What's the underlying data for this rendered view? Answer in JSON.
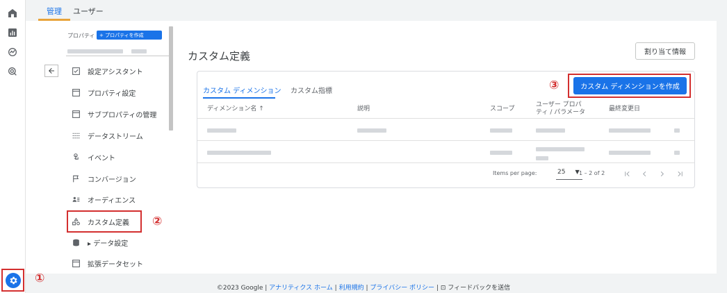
{
  "top_tabs": [
    {
      "label": "管理",
      "active": true
    },
    {
      "label": "ユーザー",
      "active": false
    }
  ],
  "rail": {
    "icons": [
      "home-icon",
      "reports-icon",
      "explore-icon",
      "advertising-icon"
    ],
    "settings_icon": "gear-icon",
    "callout": "①"
  },
  "property": {
    "label": "プロパティ",
    "create_button": "+ プロパティを作成"
  },
  "nav_items": [
    {
      "label": "設定アシスタント",
      "icon": "checklist-icon"
    },
    {
      "label": "プロパティ設定",
      "icon": "box-icon"
    },
    {
      "label": "サブプロパティの管理",
      "icon": "box-icon"
    },
    {
      "label": "データストリーム",
      "icon": "streams-icon"
    },
    {
      "label": "イベント",
      "icon": "touch-icon"
    },
    {
      "label": "コンバージョン",
      "icon": "flag-icon"
    },
    {
      "label": "オーディエンス",
      "icon": "audience-icon"
    },
    {
      "label": "カスタム定義",
      "icon": "shapes-icon"
    },
    {
      "label": "▸ データ設定",
      "icon": "database-icon"
    },
    {
      "label": "拡張データセット",
      "icon": "box-icon"
    }
  ],
  "nav_callout": "②",
  "page": {
    "title": "カスタム定義",
    "assign_button": "割り当て情報"
  },
  "tabs": [
    {
      "label": "カスタム ディメンション",
      "active": true
    },
    {
      "label": "カスタム指標",
      "active": false
    }
  ],
  "create_dimension_button": "カスタム ディメンションを作成",
  "create_callout": "③",
  "table": {
    "headers": {
      "name": "ディメンション名 ↑",
      "description": "説明",
      "scope": "スコープ",
      "user_property": "ユーザー プロパ\nティ / パラメータ",
      "last_modified": "最終変更日"
    }
  },
  "pagination": {
    "items_label": "Items per page:",
    "items_value": "25",
    "range": "1 – 2 of 2"
  },
  "footer": {
    "copyright": "©2023 Google |",
    "home": "アナリティクス ホーム",
    "sep1": "|",
    "terms": "利用規約",
    "sep2": "|",
    "privacy": "プライバシー ポリシー",
    "sep3": "|",
    "feedback": "フィードバックを送信"
  },
  "colors": {
    "accent": "#1a73e8",
    "highlight": "#d32f2f",
    "tab_underline": "#e8a33a"
  }
}
